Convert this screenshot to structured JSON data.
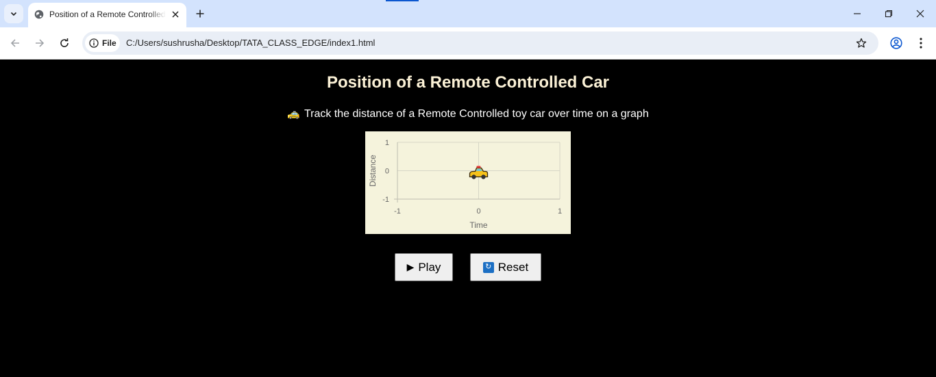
{
  "browser": {
    "tab_title": "Position of a Remote Controlled Car",
    "url_chip": "File",
    "url": "C:/Users/sushrusha/Desktop/TATA_CLASS_EDGE/index1.html",
    "icons": [
      "tab-list-icon",
      "globe-icon",
      "close-icon",
      "plus-icon",
      "minimize-icon",
      "restore-icon",
      "close-window-icon",
      "back-arrow-icon",
      "forward-arrow-icon",
      "reload-icon",
      "info-icon",
      "star-icon",
      "profile-icon",
      "more-vert-icon"
    ]
  },
  "page": {
    "title": "Position of a Remote Controlled Car",
    "subtitle_emoji": "🚕",
    "subtitle": "Track the distance of a Remote Controlled toy car over time on a graph"
  },
  "chart_data": {
    "type": "scatter",
    "x": [
      0
    ],
    "y": [
      0
    ],
    "marker": "🚖",
    "xlabel": "Time",
    "ylabel": "Distance",
    "xlim": [
      -1,
      1
    ],
    "ylim": [
      -1,
      1
    ],
    "xticks": [
      "-1",
      "0",
      "1"
    ],
    "yticks": [
      "1",
      "0",
      "-1"
    ],
    "grid": true,
    "background": "#f5f3dc"
  },
  "controls": {
    "play_icon": "▶",
    "play_label": "Play",
    "reset_icon": "🔄",
    "reset_label": "Reset"
  },
  "colors": {
    "title": "#fbf1d6",
    "page_bg": "#000000",
    "tabbar_bg": "#d3e3fd",
    "accent": "#0b57d0"
  }
}
